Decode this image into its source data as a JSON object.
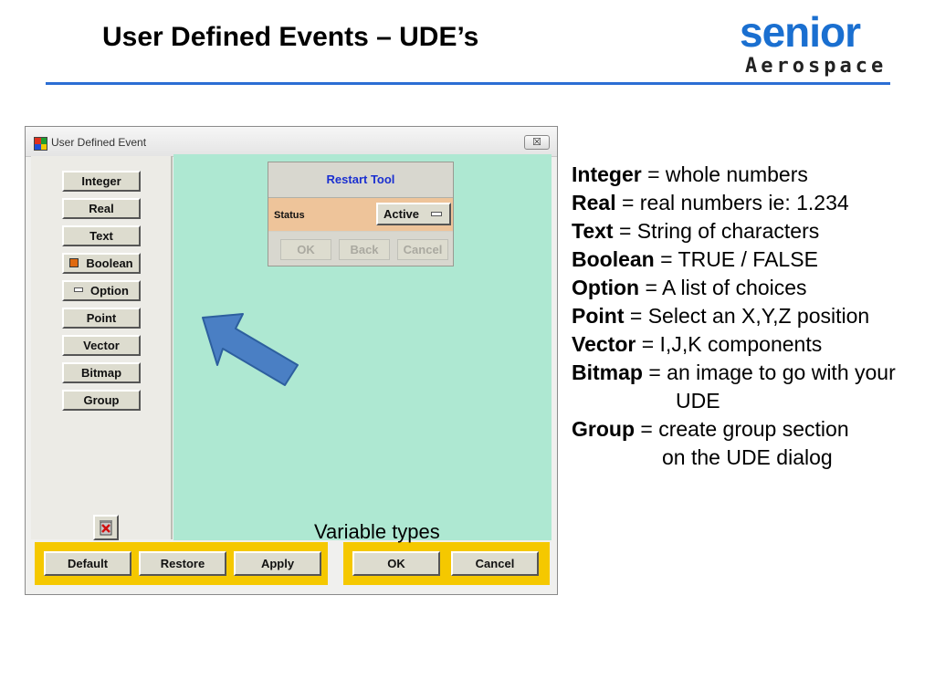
{
  "slide": {
    "title": "User Defined Events – UDE’s",
    "logo_word": "senior",
    "logo_sub": "Aerospace",
    "caption": "Variable types"
  },
  "window": {
    "title": "User Defined Event",
    "close_glyph": "☒",
    "variable_buttons": [
      "Integer",
      "Real",
      "Text",
      "Boolean",
      "Option",
      "Point",
      "Vector",
      "Bitmap",
      "Group"
    ],
    "bottom_left_buttons": [
      "Default",
      "Restore",
      "Apply"
    ],
    "bottom_right_buttons": [
      "OK",
      "Cancel"
    ]
  },
  "preview_dialog": {
    "title": "Restart Tool",
    "status_label": "Status",
    "status_value": "Active",
    "buttons": [
      "OK",
      "Back",
      "Cancel"
    ]
  },
  "legend": [
    {
      "term": "Integer",
      "desc": " = whole numbers"
    },
    {
      "term": "Real",
      "desc": " = real numbers ie: 1.234"
    },
    {
      "term": "Text",
      "desc": " = String of characters"
    },
    {
      "term": "Boolean",
      "desc": " = TRUE / FALSE"
    },
    {
      "term": "Option",
      "desc": " = A list of choices"
    },
    {
      "term": "Point",
      "desc": " = Select an X,Y,Z position"
    },
    {
      "term": "Vector",
      "desc": " = I,J,K components"
    },
    {
      "term": "Bitmap",
      "desc": " = an image to go with your",
      "cont": "UDE"
    },
    {
      "term": "Group",
      "desc": " = create group section",
      "cont": "on the UDE dialog"
    }
  ],
  "colors": {
    "accent_rule": "#2b6ed4",
    "preview_bg": "#aee8d2",
    "button_bar": "#f5c800",
    "status_row": "#eec49a",
    "arrow_fill": "#4a7fc4"
  },
  "icons": {
    "window_icon": "colored-grid-icon",
    "trash": "trash-delete-icon",
    "arrow": "pointer-arrow-icon"
  }
}
